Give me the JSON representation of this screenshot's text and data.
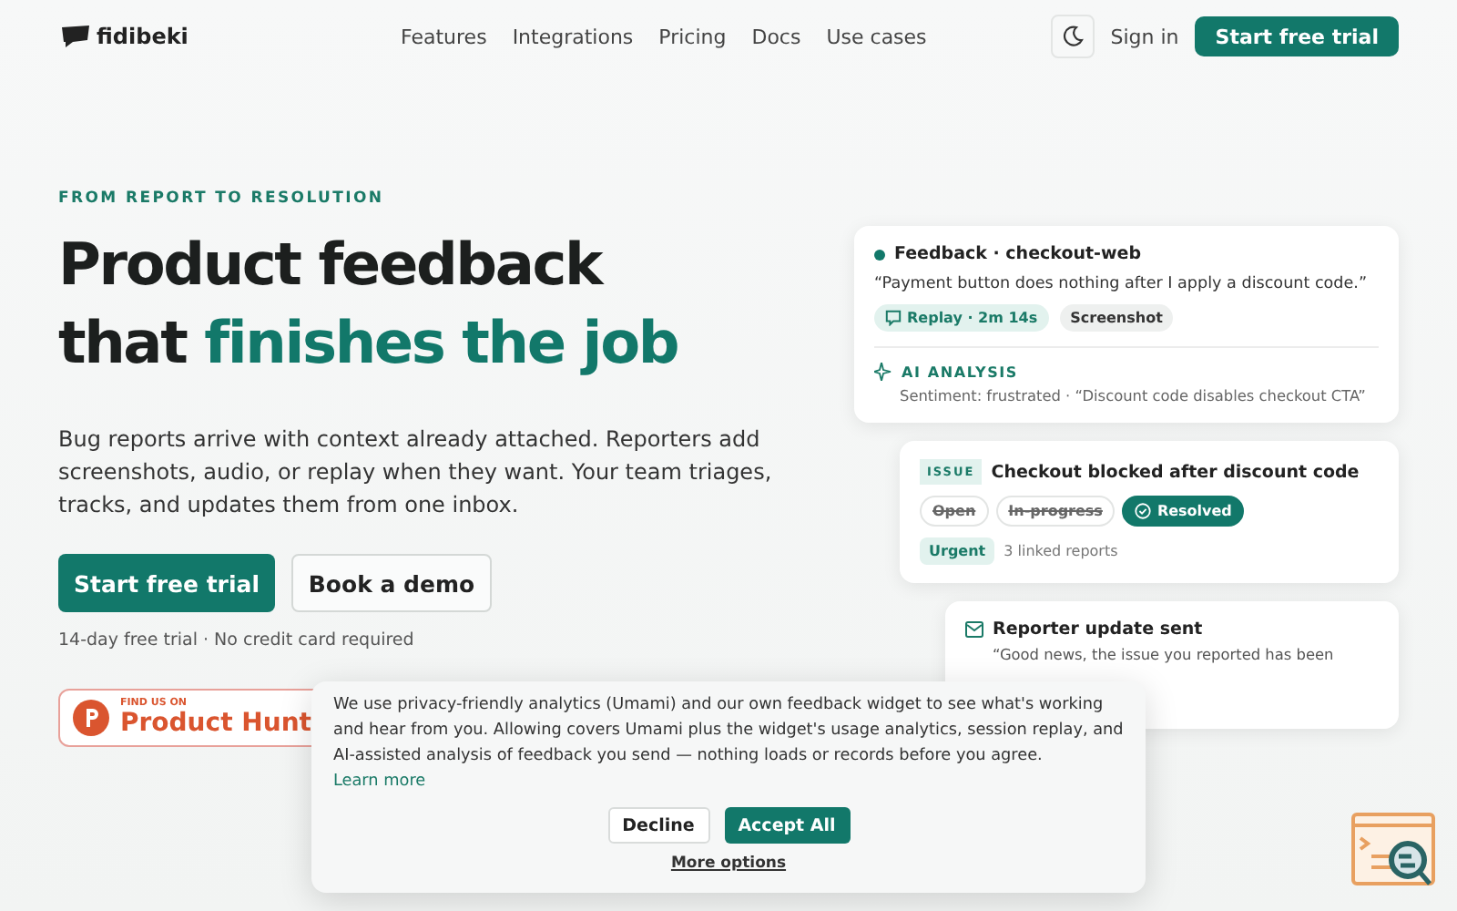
{
  "header": {
    "logo": "fidibeki",
    "nav": [
      "Features",
      "Integrations",
      "Pricing",
      "Docs",
      "Use cases"
    ],
    "sign_in": "Sign in",
    "cta": "Start free trial"
  },
  "hero": {
    "eyebrow": "FROM REPORT TO RESOLUTION",
    "title_line1": "Product feedback",
    "title_line2_plain": "that",
    "title_line2_accent": "finishes the job",
    "lead": "Bug reports arrive with context already attached. Reporters add screenshots, audio, or replay when they want. Your team triages, tracks, and updates them from one inbox.",
    "primary": "Start free trial",
    "secondary": "Book a demo",
    "note": "14-day free trial · No credit card required",
    "badge_small": "FIND US ON",
    "badge_big": "Product Hunt"
  },
  "feedback_card": {
    "title": "Feedback · checkout-web",
    "quote": "“Payment button does nothing after I apply a discount code.”",
    "chips": [
      {
        "label": "Replay · 2m 14s",
        "kind": "replay"
      },
      {
        "label": "Screenshot",
        "kind": "plain"
      }
    ],
    "ai_label": "AI ANALYSIS",
    "ai_text": "Sentiment: frustrated · “Discount code disables checkout CTA”"
  },
  "issue_card": {
    "tag": "ISSUE",
    "title": "Checkout blocked after discount code",
    "statuses": [
      {
        "label": "Open",
        "selected": false,
        "struck": true
      },
      {
        "label": "In-progress",
        "selected": false,
        "struck": true
      },
      {
        "label": "Resolved",
        "selected": true,
        "struck": false
      }
    ],
    "priority": "Urgent",
    "linked": "3 linked reports"
  },
  "update_card": {
    "title": "Reporter update sent",
    "text": "“Good news, the issue you reported has been"
  },
  "cookie_banner": {
    "text": "We use privacy-friendly analytics (Umami) and our own feedback widget to see what's working and hear from you. Allowing covers Umami plus the widget's usage analytics, session replay, and AI-assisted analysis of feedback you send — nothing loads or records before you agree.",
    "learn_more": "Learn more",
    "decline": "Decline",
    "accept": "Accept All",
    "more": "More options"
  }
}
